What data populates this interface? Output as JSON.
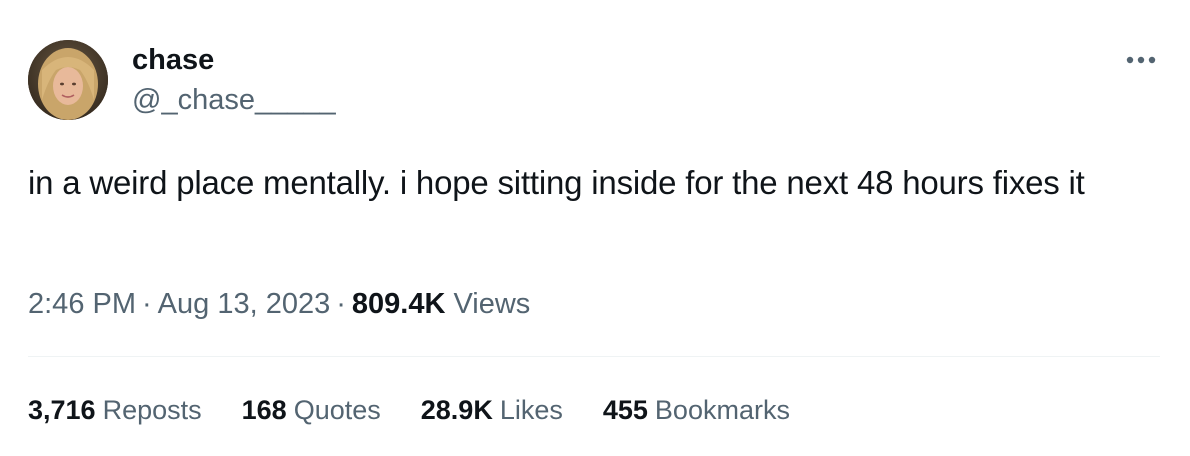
{
  "author": {
    "display_name": "chase",
    "handle": "@_chase_____"
  },
  "more_icon": "more-dots-icon",
  "tweet": {
    "text": "in a weird place mentally. i hope sitting inside for the next 48 hours fixes it"
  },
  "meta": {
    "time": "2:46 PM",
    "separator": "·",
    "date": "Aug 13, 2023",
    "views_count": "809.4K",
    "views_label": "Views"
  },
  "stats": [
    {
      "count": "3,716",
      "label": "Reposts"
    },
    {
      "count": "168",
      "label": "Quotes"
    },
    {
      "count": "28.9K",
      "label": "Likes"
    },
    {
      "count": "455",
      "label": "Bookmarks"
    }
  ],
  "colors": {
    "text_primary": "#0f1419",
    "text_secondary": "#536471",
    "divider": "#eff3f4"
  }
}
